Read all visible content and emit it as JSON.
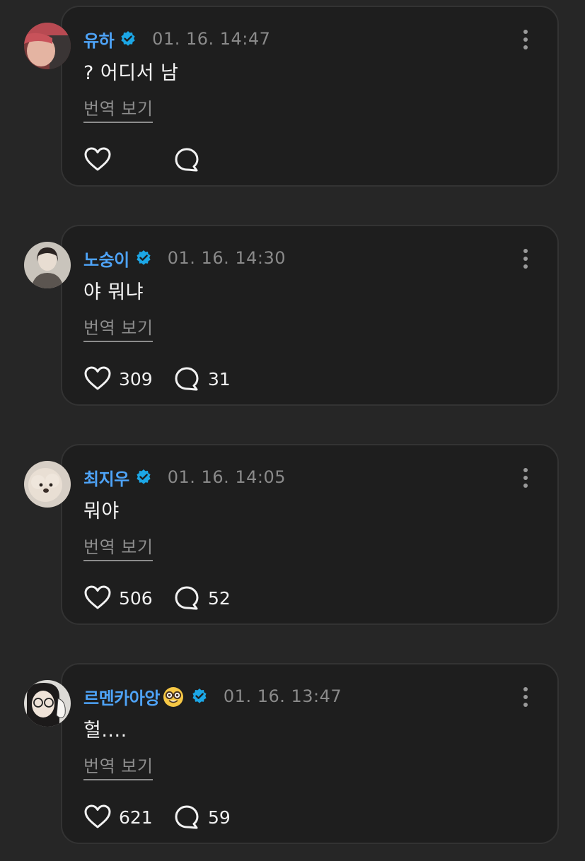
{
  "comments": [
    {
      "username": "유하",
      "verified": true,
      "timestamp": "01. 16. 14:47",
      "text": "? 어디서 남",
      "translate_label": "번역 보기",
      "likes": "",
      "replies": ""
    },
    {
      "username": "노숭이",
      "verified": true,
      "timestamp": "01. 16. 14:30",
      "text": "야 뭐냐",
      "translate_label": "번역 보기",
      "likes": "309",
      "replies": "31"
    },
    {
      "username": "최지우",
      "verified": true,
      "timestamp": "01. 16. 14:05",
      "text": "뭐야",
      "translate_label": "번역 보기",
      "likes": "506",
      "replies": "52"
    },
    {
      "username": "르멘카아앙",
      "username_emoji": "nerd-face-emoji",
      "verified": true,
      "timestamp": "01. 16. 13:47",
      "text": "헐....",
      "translate_label": "번역 보기",
      "likes": "621",
      "replies": "59"
    }
  ],
  "icons": {
    "verified": "verified-badge-icon",
    "more": "more-vertical-icon",
    "like": "heart-icon",
    "reply": "reply-bubble-icon"
  },
  "colors": {
    "background": "#262626",
    "card": "#1e1e1e",
    "username": "#4ea3f7",
    "verified_badge": "#1ca7e6",
    "timestamp": "#8a8a8a"
  }
}
